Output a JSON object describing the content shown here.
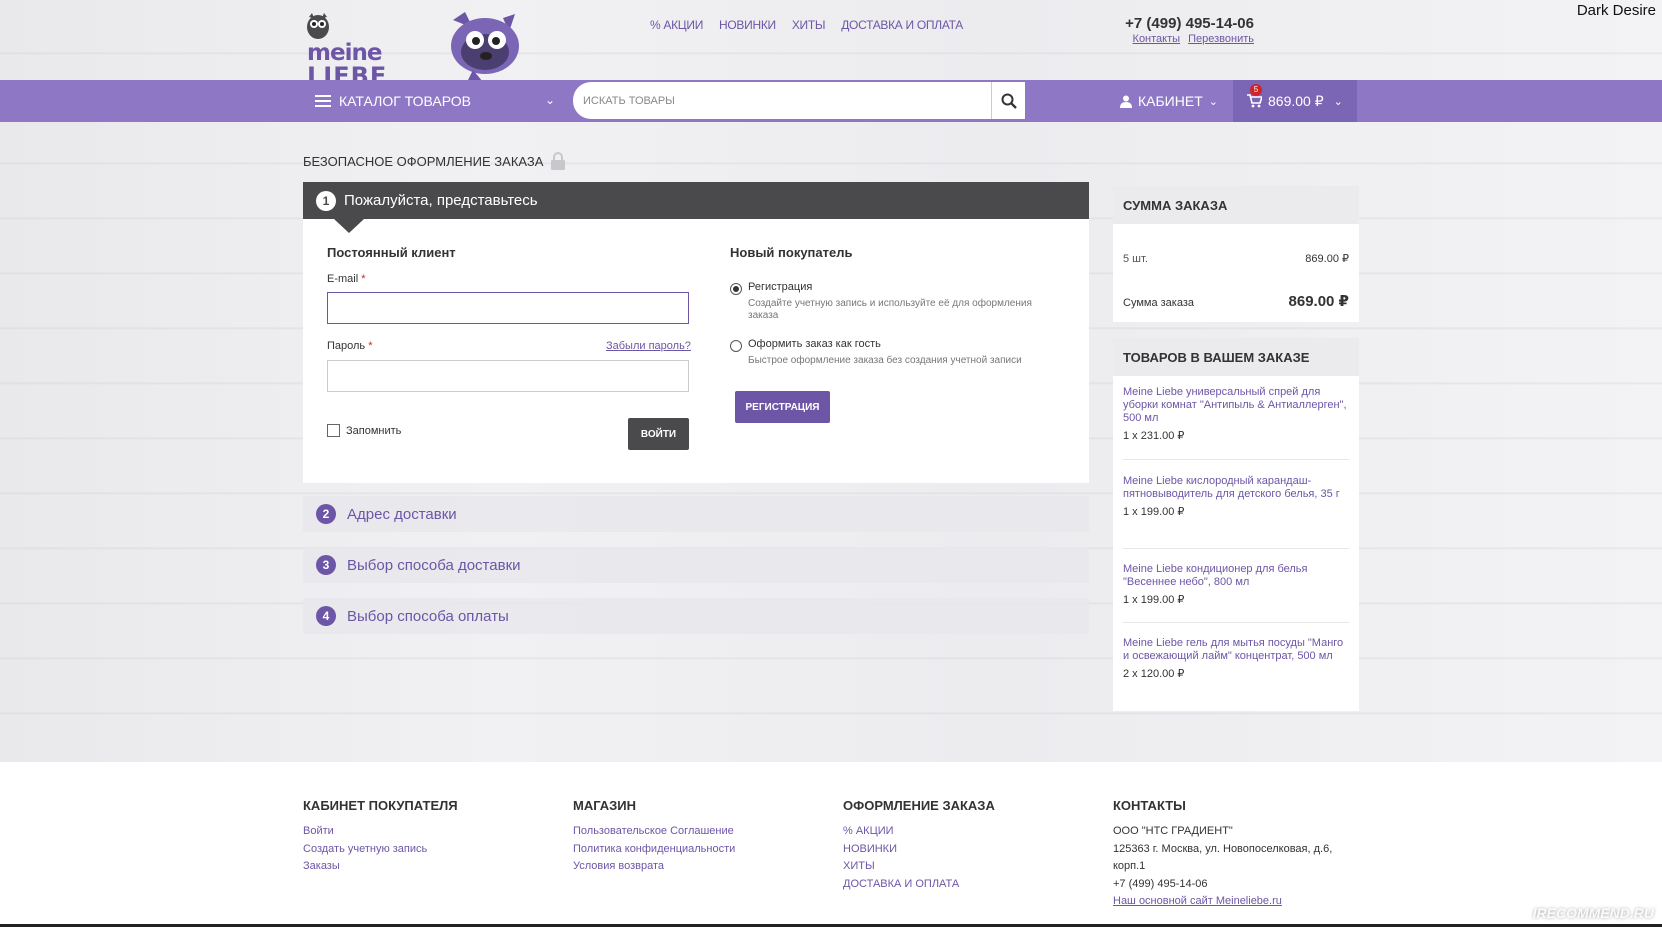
{
  "header": {
    "brand_line1": "meine",
    "brand_line2": "LIEBE",
    "nav": [
      "% АКЦИИ",
      "НОВИНКИ",
      "ХИТЫ",
      "ДОСТАВКА И ОПЛАТА"
    ],
    "phone": "+7 (499) 495-14-06",
    "contacts_link": "Контакты",
    "callback_link": "Перезвонить",
    "corner_user": "Dark Desire"
  },
  "bar": {
    "catalog_label": "КАТАЛОГ ТОВАРОВ",
    "search_placeholder": "ИСКАТЬ ТОВАРЫ",
    "cabinet_label": "КАБИНЕТ",
    "cart_count": "5",
    "cart_total": "869.00 ₽"
  },
  "secure_label": "БЕЗОПАСНОЕ ОФОРМЛЕНИЕ ЗАКАЗА",
  "step1": {
    "num": "1",
    "title": "Пожалуйста, представьтесь",
    "returning": {
      "title": "Постоянный клиент",
      "email_label": "E-mail",
      "email_value": "",
      "password_label": "Пароль",
      "password_value": "",
      "forgot": "Забыли пароль?",
      "remember": "Запомнить",
      "login_button": "ВОЙТИ"
    },
    "new_customer": {
      "title": "Новый покупатель",
      "option1_title": "Регистрация",
      "option1_desc": "Создайте учетную запись и используйте её для оформления заказа",
      "option2_title": "Оформить заказ как гость",
      "option2_desc": "Быстрое оформление заказа без создания учетной записи",
      "register_button": "РЕГИСТРАЦИЯ"
    },
    "required_mark": "*"
  },
  "steps": [
    {
      "num": "2",
      "title": "Адрес доставки"
    },
    {
      "num": "3",
      "title": "Выбор способа доставки"
    },
    {
      "num": "4",
      "title": "Выбор способа оплаты"
    }
  ],
  "summary": {
    "title": "СУММА ЗАКАЗА",
    "qty_label": "5 шт.",
    "qty_value": "869.00 ₽",
    "total_label": "Сумма заказа",
    "total_value": "869.00 ₽"
  },
  "items": {
    "title": "ТОВАРОВ В ВАШЕМ ЗАКАЗЕ",
    "list": [
      {
        "name": "Meine Liebe универсальный спрей для уборки комнат \"Антипыль & Антиаллерген\", 500 мл",
        "qty": "1 x 231.00 ₽"
      },
      {
        "name": "Meine Liebe кислородный карандаш-пятновыводитель для детского белья, 35 г",
        "qty": "1 x 199.00 ₽"
      },
      {
        "name": "Meine Liebe кондиционер для белья \"Весеннее небо\", 800 мл",
        "qty": "1 x 199.00 ₽"
      },
      {
        "name": "Meine Liebe гель для мытья посуды \"Манго и освежающий лайм\" концентрат, 500 мл",
        "qty": "2 x 120.00 ₽"
      }
    ]
  },
  "footer": {
    "cabinet": {
      "title": "КАБИНЕТ ПОКУПАТЕЛЯ",
      "links": [
        "Войти",
        "Создать учетную запись",
        "Заказы"
      ]
    },
    "shop": {
      "title": "МАГАЗИН",
      "links": [
        "Пользовательское Соглашение",
        "Политика конфиденциальности",
        "Условия возврата"
      ]
    },
    "order": {
      "title": "ОФОРМЛЕНИЕ ЗАКАЗА",
      "links": [
        "% АКЦИИ",
        "НОВИНКИ",
        "ХИТЫ",
        "ДОСТАВКА И ОПЛАТА"
      ]
    },
    "contacts": {
      "title": "КОНТАКТЫ",
      "company": "ООО \"НТС ГРАДИЕНТ\"",
      "address": "125363 г. Москва, ул. Новопоселковая, д.6, корп.1",
      "phone": "+7 (499) 495-14-06",
      "site_link": "Наш основной сайт Meineliebe.ru"
    }
  },
  "watermark": "IRECOMMEND.RU",
  "colors": {
    "accent": "#6d56a6",
    "bar": "#8e78c6",
    "dark": "#4a4a4c"
  }
}
